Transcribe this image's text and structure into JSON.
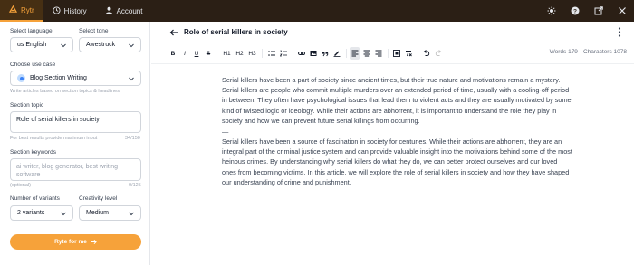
{
  "topbar": {
    "tabs": [
      {
        "label": "Rytr",
        "icon": "rytr-logo-icon",
        "active": true
      },
      {
        "label": "History",
        "icon": "history-icon",
        "active": false
      },
      {
        "label": "Account",
        "icon": "user-icon",
        "active": false
      }
    ],
    "right_icons": [
      "sun-icon",
      "help-icon",
      "external-link-icon",
      "close-icon"
    ]
  },
  "sidebar": {
    "language": {
      "label": "Select language",
      "value": "us English"
    },
    "tone": {
      "label": "Select tone",
      "value": "Awestruck"
    },
    "use_case": {
      "label": "Choose use case",
      "value": "Blog Section Writing",
      "hint": "Write articles based on section topics & headlines"
    },
    "section_topic": {
      "label": "Section topic",
      "value": "Role of serial killers in society",
      "hint": "For best results provide maximum input",
      "count": "34/150"
    },
    "section_keywords": {
      "label": "Section keywords",
      "placeholder": "ai writer, blog generator, best writing software",
      "hint": "(optional)",
      "count": "0/125"
    },
    "variants": {
      "label": "Number of variants",
      "value": "2 variants"
    },
    "creativity": {
      "label": "Creativity level",
      "value": "Medium"
    },
    "ryte_button": "Ryte for me"
  },
  "editor": {
    "title": "Role of serial killers in society",
    "toolbar": {
      "text_buttons": [
        "B",
        "I",
        "U",
        "S",
        "H1",
        "H2",
        "H3"
      ],
      "icon_buttons": [
        "bullet-list-icon",
        "numbered-list-icon",
        "link-icon",
        "image-icon",
        "quote-icon",
        "highlight-icon",
        "align-left-icon",
        "align-center-icon",
        "align-right-icon",
        "clear-format-icon",
        "undo-icon",
        "redo-icon"
      ]
    },
    "words_label": "Words 179",
    "characters_label": "Characters 1078",
    "paragraph_1": "Serial killers have been a part of society since ancient times, but their true nature and motivations remain a mystery. Serial killers are people who commit multiple murders over an extended period of time, usually with a cooling-off period in between. They often have psychological issues that lead them to violent acts and they are usually motivated by some kind of twisted logic or ideology. While their actions are abhorrent, it is important to understand the role they play in society and how we can prevent future serial killings from occurring.",
    "separator": "—",
    "paragraph_2": "Serial killers have been a source of fascination in society for centuries. While their actions are abhorrent, they are an integral part of the criminal justice system and can provide valuable insight into the motivations behind some of the most heinous crimes. By understanding why serial killers do what they do, we can better protect ourselves and our loved ones from becoming victims. In this article, we will explore the role of serial killers in society and how they have shaped our understanding of crime and punishment."
  },
  "colors": {
    "topbar_bg": "#2b1f15",
    "accent": "#f6a23a"
  }
}
